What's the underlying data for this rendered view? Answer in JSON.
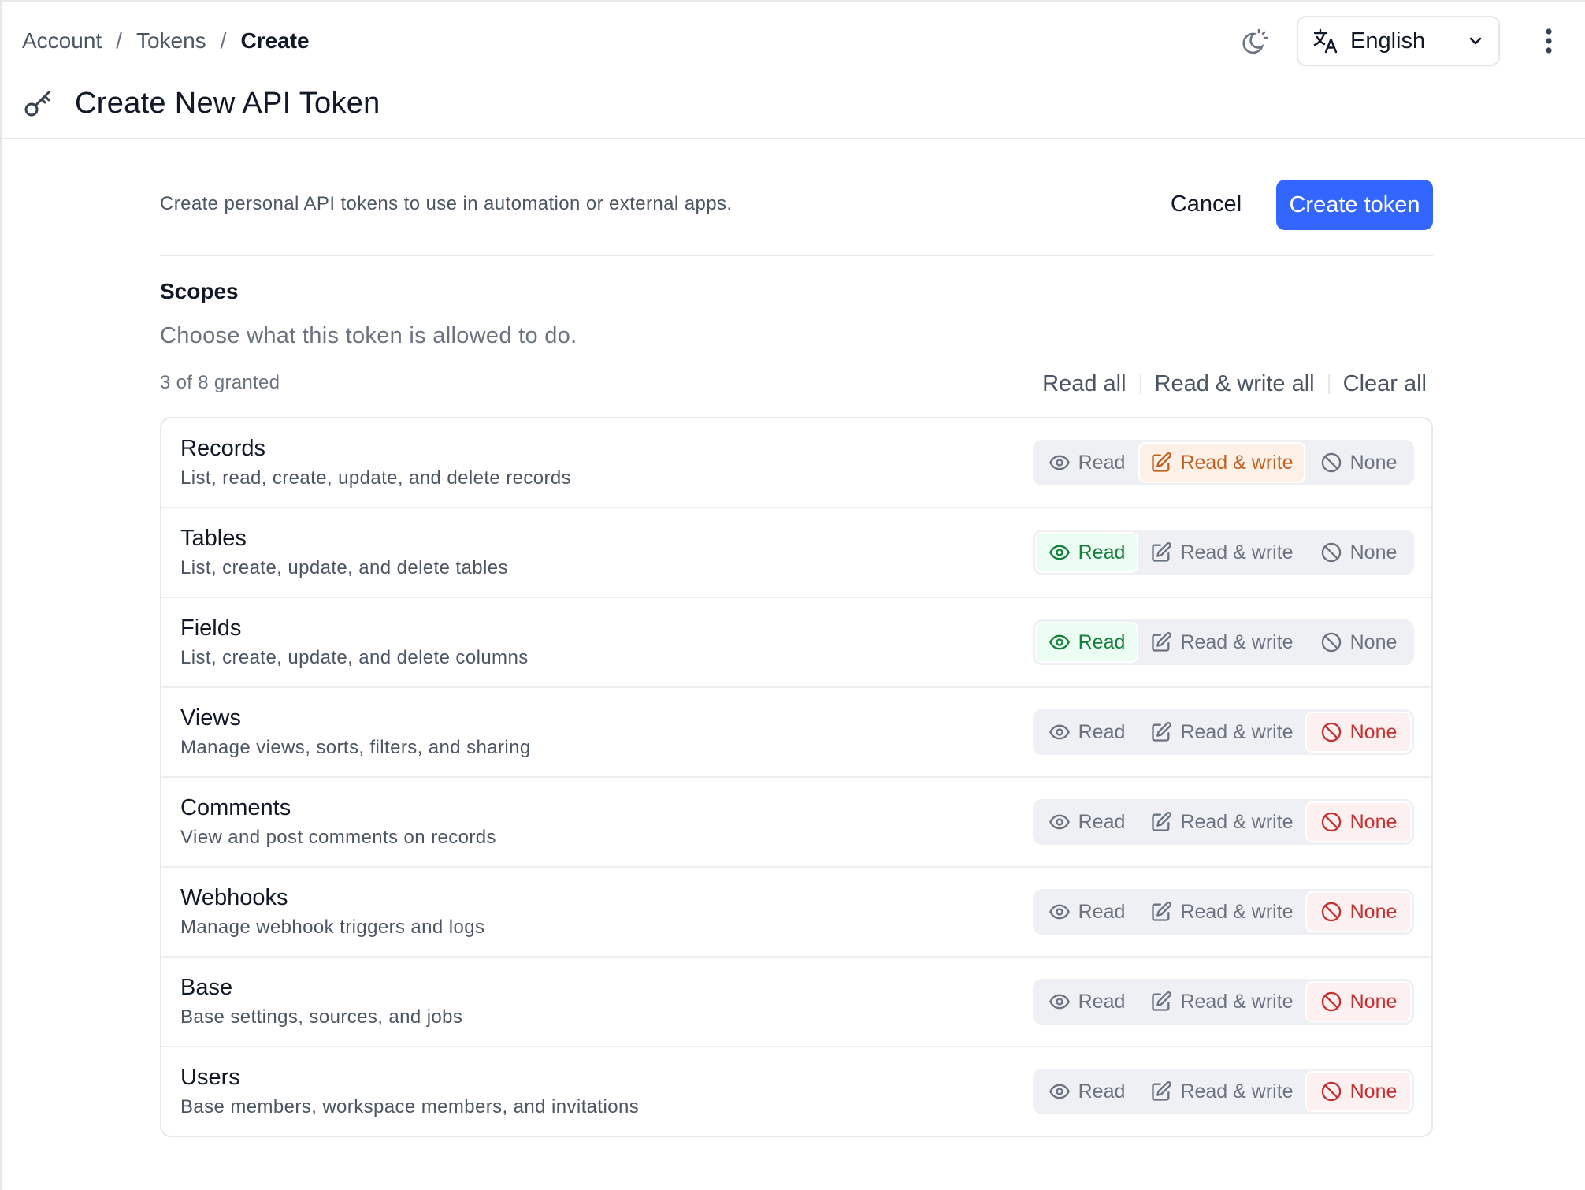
{
  "breadcrumb": {
    "items": [
      "Account",
      "Tokens"
    ],
    "current": "Create",
    "separator": "/"
  },
  "header": {
    "title": "Create New API Token",
    "language": "English"
  },
  "intro": {
    "text": "Create personal API tokens to use in automation or external apps.",
    "cancel_label": "Cancel",
    "create_label": "Create token"
  },
  "scopes": {
    "title": "Scopes",
    "subtitle": "Choose what this token is allowed to do.",
    "granted_text": "3 of 8 granted",
    "bulk": {
      "read_all": "Read all",
      "read_write_all": "Read & write all",
      "clear_all": "Clear all"
    },
    "option_labels": {
      "read": "Read",
      "read_write": "Read & write",
      "none": "None"
    },
    "rows": [
      {
        "name": "Records",
        "description": "List, read, create, update, and delete records",
        "selected": "read_write"
      },
      {
        "name": "Tables",
        "description": "List, create, update, and delete tables",
        "selected": "read"
      },
      {
        "name": "Fields",
        "description": "List, create, update, and delete columns",
        "selected": "read"
      },
      {
        "name": "Views",
        "description": "Manage views, sorts, filters, and sharing",
        "selected": "none"
      },
      {
        "name": "Comments",
        "description": "View and post comments on records",
        "selected": "none"
      },
      {
        "name": "Webhooks",
        "description": "Manage webhook triggers and logs",
        "selected": "none"
      },
      {
        "name": "Base",
        "description": "Base settings, sources, and jobs",
        "selected": "none"
      },
      {
        "name": "Users",
        "description": "Base members, workspace members, and invitations",
        "selected": "none"
      }
    ]
  },
  "icons": {
    "title": "key-icon",
    "theme": "theme-toggle-icon",
    "language": "translate-icon",
    "dropdown": "chevron-down-icon",
    "menu": "more-vertical-icon",
    "read": "eye-icon",
    "read_write": "edit-icon",
    "none": "ban-icon"
  },
  "colors": {
    "primary": "#3366ff",
    "read_active": "#15803d",
    "read_write_active": "#c2611f",
    "none_active": "#c53030"
  }
}
